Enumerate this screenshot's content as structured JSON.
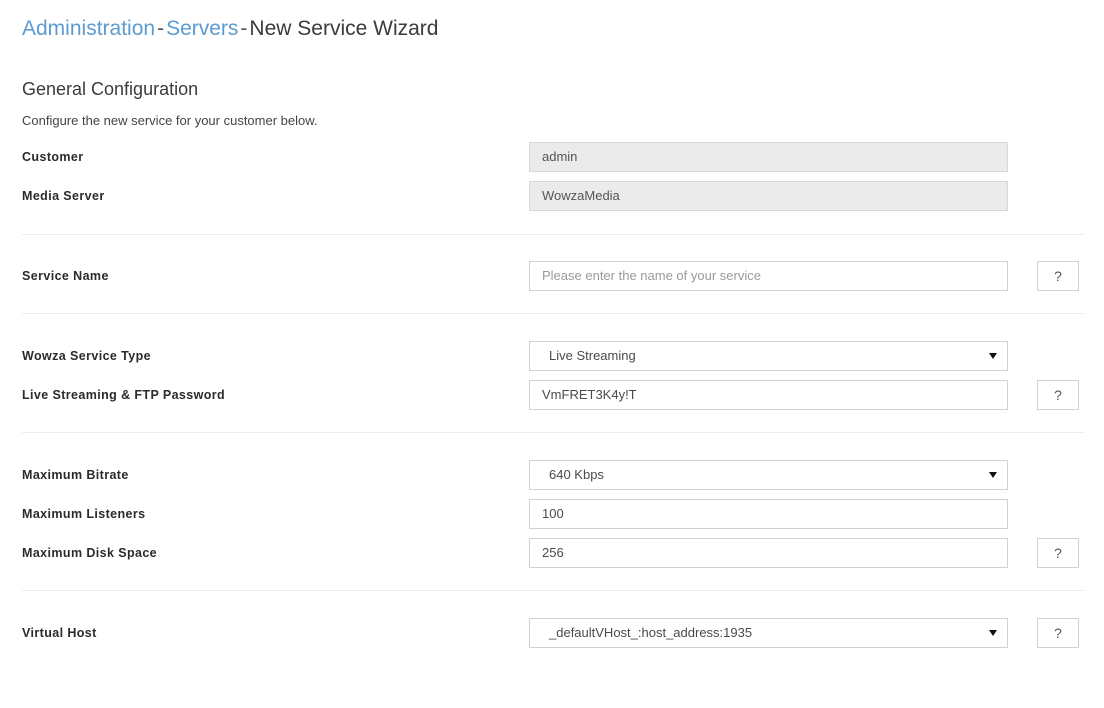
{
  "breadcrumb": {
    "item1": "Administration",
    "sep1": "-",
    "item2": "Servers",
    "sep2": "-",
    "current": "New Service Wizard"
  },
  "section": {
    "title": "General Configuration",
    "subtitle": "Configure the new service for your customer below."
  },
  "help_label": "?",
  "fields": {
    "customer": {
      "label": "Customer",
      "value": "admin"
    },
    "media_server": {
      "label": "Media Server",
      "value": "WowzaMedia"
    },
    "service_name": {
      "label": "Service Name",
      "value": "",
      "placeholder": "Please enter the name of your service"
    },
    "service_type": {
      "label": "Wowza Service Type",
      "value": "Live Streaming"
    },
    "password": {
      "label": "Live Streaming & FTP Password",
      "value": "VmFRET3K4y!T"
    },
    "max_bitrate": {
      "label": "Maximum Bitrate",
      "value": "640 Kbps"
    },
    "max_listeners": {
      "label": "Maximum Listeners",
      "value": "100"
    },
    "max_disk_space": {
      "label": "Maximum Disk Space",
      "value": "256"
    },
    "virtual_host": {
      "label": "Virtual Host",
      "value": "_defaultVHost_:host_address:1935"
    }
  },
  "colors": {
    "link": "#5b9bd0",
    "text": "#333333",
    "border": "#d2d2d2",
    "disabled_bg": "#ebebeb",
    "divider": "#ededed"
  }
}
